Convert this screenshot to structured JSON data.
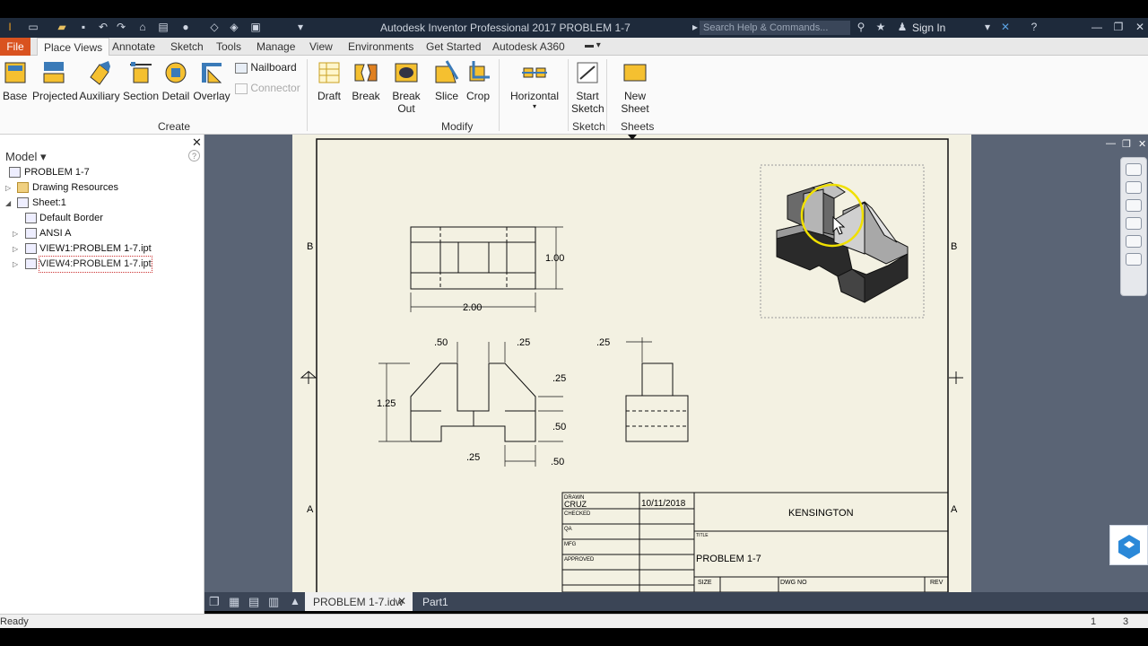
{
  "titlebar": {
    "title": "Autodesk Inventor Professional 2017   PROBLEM 1-7",
    "search_placeholder": "Search Help & Commands...",
    "sign_in": "Sign In"
  },
  "menu_tabs": {
    "file": "File",
    "items": [
      "Place Views",
      "Annotate",
      "Sketch",
      "Tools",
      "Manage",
      "View",
      "Environments",
      "Get Started",
      "Autodesk A360"
    ]
  },
  "ribbon": {
    "create": [
      "Base",
      "Projected",
      "Auxiliary",
      "Section",
      "Detail",
      "Overlay"
    ],
    "nailboard": "Nailboard",
    "connector": "Connector",
    "modify": [
      "Draft",
      "Break",
      "Break Out",
      "Slice",
      "Crop"
    ],
    "horizontal": "Horizontal",
    "start_sketch": [
      "Start",
      "Sketch"
    ],
    "new_sheet": "New Sheet",
    "groups": {
      "create": "Create",
      "modify": "Modify",
      "sketch": "Sketch",
      "sheets": "Sheets"
    }
  },
  "browser": {
    "header": "Model",
    "help": "?",
    "items": [
      "PROBLEM 1-7",
      "Drawing Resources",
      "Sheet:1",
      "Default Border",
      "ANSI A",
      "VIEW1:PROBLEM 1-7.ipt",
      "VIEW4:PROBLEM 1-7.ipt"
    ]
  },
  "drawing": {
    "zones": {
      "b": "B",
      "a": "A"
    },
    "dims": {
      "top_height": "1.00",
      "top_width": "2.00",
      "front_left_w": ".50",
      "front_gap": ".25",
      "front_height": "1.25",
      "front_right_top": ".25",
      "front_right_mid": ".50",
      "front_bottom": ".25",
      "front_bottom_right": ".50",
      "side_top": ".25"
    },
    "title_block": {
      "drawn": "DRAWN",
      "drawn_by": "CRUZ",
      "date": "10/11/2018",
      "checked": "CHECKED",
      "qa": "QA",
      "mfg": "MFG",
      "approved": "APPROVED",
      "company": "KENSINGTON",
      "title_label": "TITLE",
      "title": "PROBLEM 1-7",
      "size": "SIZE",
      "dwg_no": "DWG NO",
      "rev": "REV"
    }
  },
  "doc_tabs": [
    "PROBLEM 1-7.idw",
    "Part1"
  ],
  "status": {
    "text": "Ready",
    "num1": "1",
    "num2": "3"
  }
}
